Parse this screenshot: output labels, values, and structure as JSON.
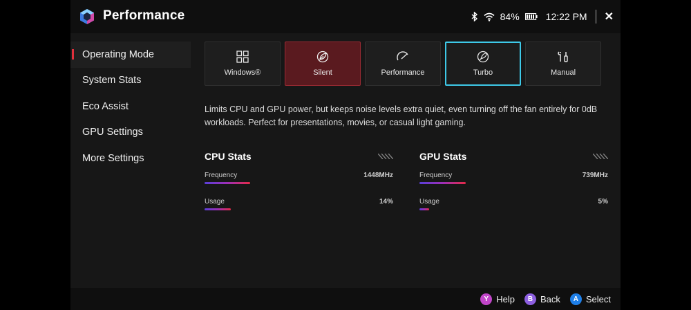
{
  "app": {
    "title": "Performance"
  },
  "status": {
    "battery": "84%",
    "time": "12:22 PM"
  },
  "sidebar": {
    "items": [
      {
        "label": "Operating Mode"
      },
      {
        "label": "System Stats"
      },
      {
        "label": "Eco Assist"
      },
      {
        "label": "GPU Settings"
      },
      {
        "label": "More Settings"
      }
    ]
  },
  "modes": [
    {
      "label": "Windows®",
      "icon": "windows-grid-icon"
    },
    {
      "label": "Silent",
      "icon": "leaf-icon"
    },
    {
      "label": "Performance",
      "icon": "gauge-icon"
    },
    {
      "label": "Turbo",
      "icon": "rocket-icon"
    },
    {
      "label": "Manual",
      "icon": "tools-icon"
    }
  ],
  "description": "Limits CPU and GPU power, but keeps noise levels extra quiet, even turning off the fan entirely for 0dB workloads. Perfect for presentations, movies, or casual light gaming.",
  "cpu": {
    "title": "CPU Stats",
    "frequency_label": "Frequency",
    "frequency_value": "1448MHz",
    "frequency_fraction": 0.24,
    "usage_label": "Usage",
    "usage_value": "14%",
    "usage_fraction": 0.14
  },
  "gpu": {
    "title": "GPU Stats",
    "frequency_label": "Frequency",
    "frequency_value": "739MHz",
    "frequency_fraction": 0.245,
    "usage_label": "Usage",
    "usage_value": "5%",
    "usage_fraction": 0.05
  },
  "footer": {
    "help": "Help",
    "back": "Back",
    "select": "Select",
    "y": "Y",
    "b": "B",
    "a": "A"
  },
  "colors": {
    "accent_red": "#e0303c",
    "focus_cyan": "#3ec9e8",
    "y_button": "#c145c9",
    "b_button": "#8d5fe0",
    "a_button": "#1e7fe8"
  }
}
